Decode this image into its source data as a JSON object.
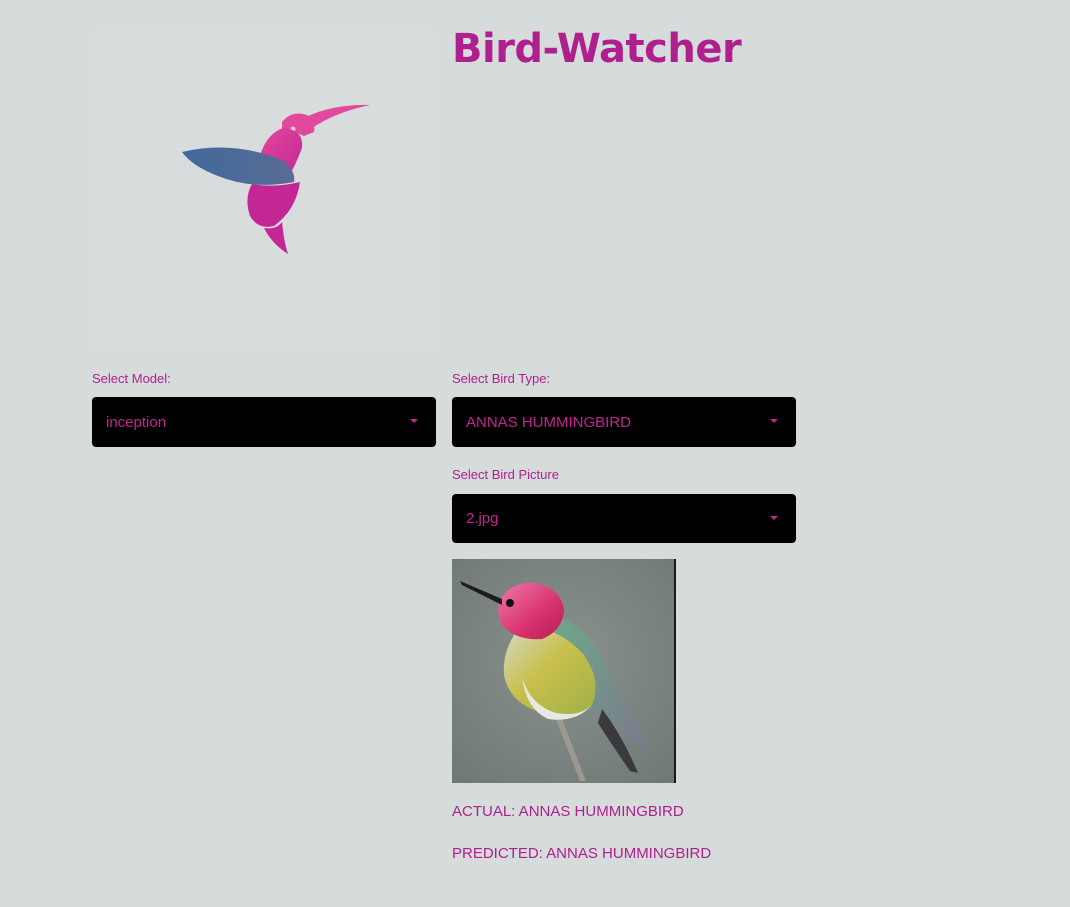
{
  "app": {
    "title": "Bird-Watcher"
  },
  "model_select": {
    "label": "Select Model:",
    "value": "inception"
  },
  "bird_type_select": {
    "label": "Select Bird Type:",
    "value": "ANNAS HUMMINGBIRD"
  },
  "picture_select": {
    "label": "Select Bird Picture",
    "value": "2.jpg"
  },
  "results": {
    "actual": "ACTUAL: ANNAS HUMMINGBIRD",
    "predicted": "PREDICTED: ANNAS HUMMINGBIRD"
  },
  "icons": {
    "logo": "hummingbird-logo-icon",
    "dropdown": "caret-down-icon"
  },
  "colors": {
    "background": "#d6dbdb",
    "accent": "#b01f8e",
    "select_bg": "#000000",
    "logo_blue": "#4a6a98",
    "logo_pink": "#e0409a"
  }
}
